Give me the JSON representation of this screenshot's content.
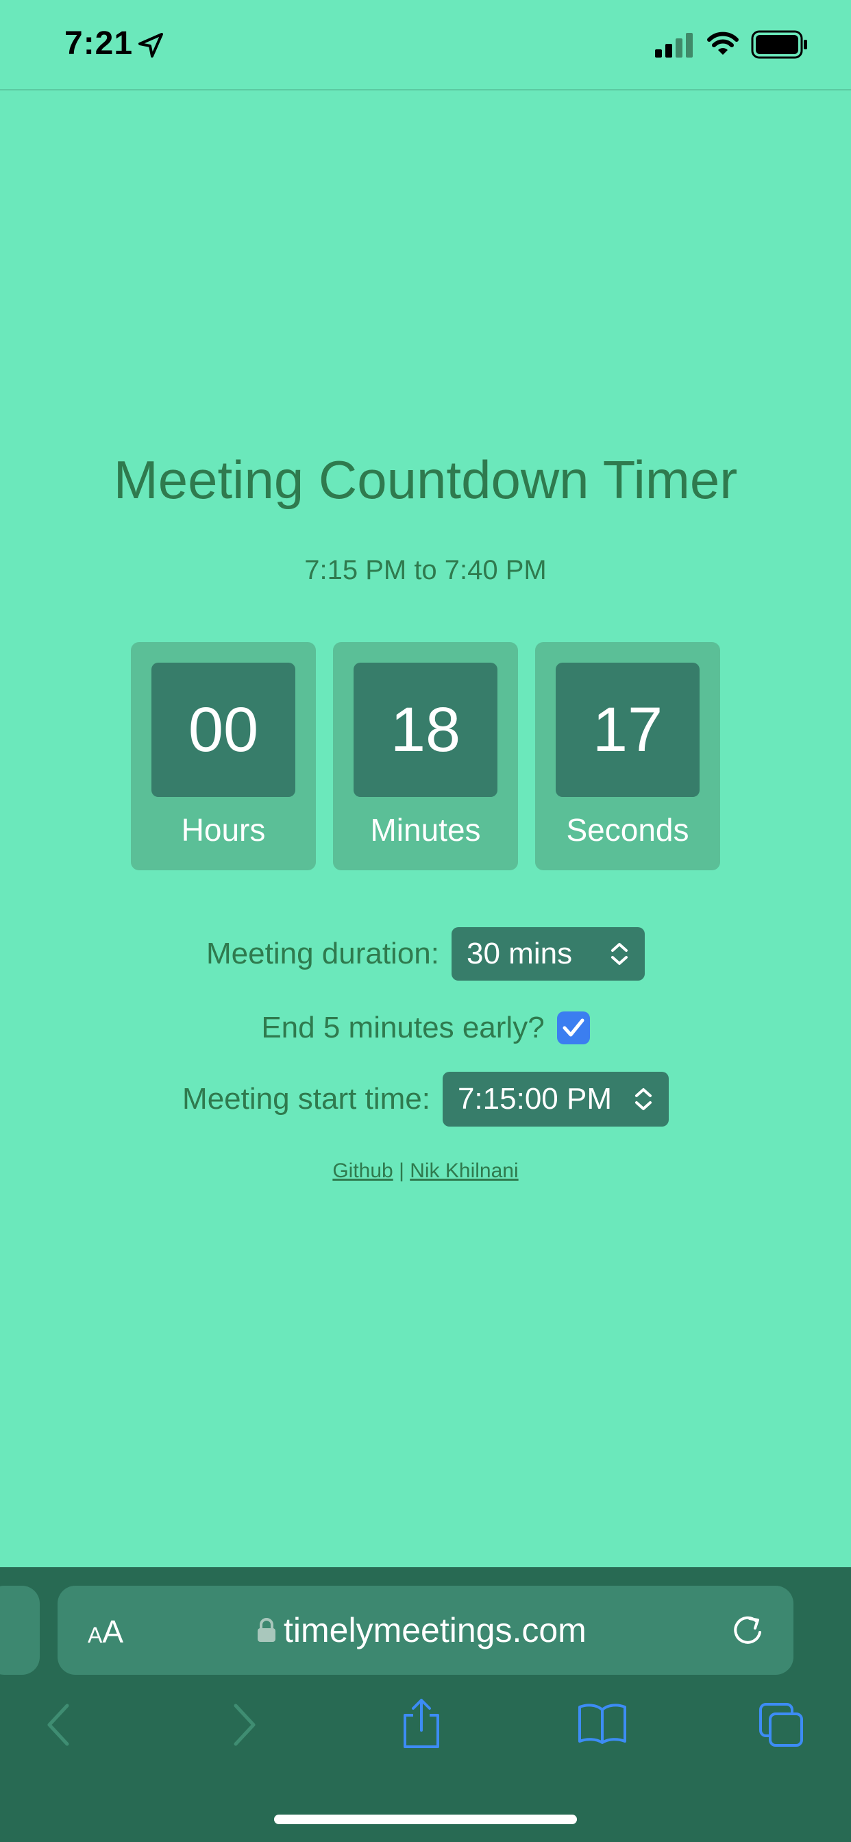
{
  "status_bar": {
    "time": "7:21"
  },
  "page": {
    "title": "Meeting Countdown Timer",
    "subtitle": "7:15 PM to 7:40 PM"
  },
  "countdown": [
    {
      "value": "00",
      "label": "Hours"
    },
    {
      "value": "18",
      "label": "Minutes"
    },
    {
      "value": "17",
      "label": "Seconds"
    }
  ],
  "form": {
    "duration_label": "Meeting duration:",
    "duration_value": "30 mins",
    "end_early_label": "End 5 minutes early?",
    "end_early_checked": true,
    "start_time_label": "Meeting start time:",
    "start_time_value": "7:15:00 PM"
  },
  "links": {
    "github": "Github",
    "separator": "|",
    "author": "Nik Khilnani"
  },
  "browser": {
    "text_size_small": "A",
    "text_size_big": "A",
    "url": "timelymeetings.com"
  },
  "colors": {
    "background": "#6be8bb",
    "accent_text": "#2f7a4e",
    "card": "#5bbf97",
    "card_inner": "#377d6a",
    "checkbox": "#3b7ef0",
    "browser_bar": "#286a53"
  }
}
